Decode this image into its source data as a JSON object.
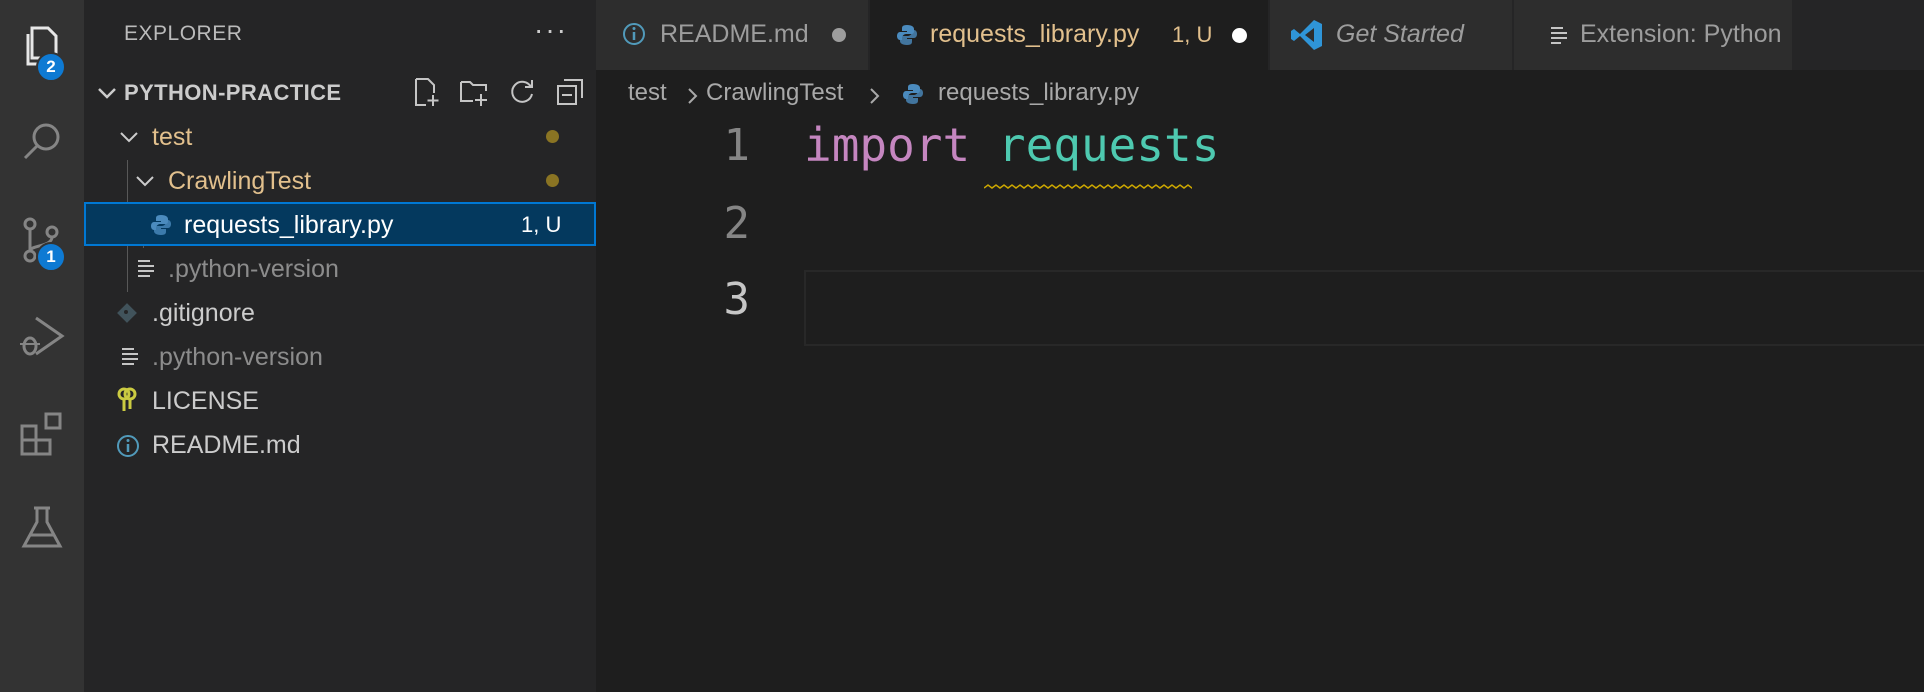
{
  "activity_bar": {
    "explorer_badge": "2",
    "scm_badge": "1",
    "icons": [
      "files-icon",
      "search-icon",
      "source-control-icon",
      "run-debug-icon",
      "extensions-icon",
      "testing-icon"
    ]
  },
  "sidebar": {
    "header": "EXPLORER",
    "more": "···",
    "section_title": "PYTHON-PRACTICE",
    "tree": [
      {
        "label": "test",
        "kind": "folder",
        "status_dot": true
      },
      {
        "label": "CrawlingTest",
        "kind": "folder",
        "status_dot": true
      },
      {
        "label": "requests_library.py",
        "kind": "python-file",
        "status": "1, U",
        "selected": true
      },
      {
        "label": ".python-version",
        "kind": "text-file"
      },
      {
        "label": ".gitignore",
        "kind": "git-file"
      },
      {
        "label": ".python-version",
        "kind": "text-file"
      },
      {
        "label": "LICENSE",
        "kind": "license-file"
      },
      {
        "label": "README.md",
        "kind": "info-file"
      }
    ]
  },
  "tabs": [
    {
      "label": "README.md",
      "modified": true,
      "icon": "info-icon"
    },
    {
      "label": "requests_library.py",
      "badge": "1, U",
      "modified": true,
      "active": true,
      "icon": "python-icon"
    },
    {
      "label": "Get Started",
      "icon": "vscode-icon"
    },
    {
      "label": "Extension: Python",
      "icon": "preview-icon"
    }
  ],
  "breadcrumb": [
    "test",
    "CrawlingTest",
    "requests_library.py"
  ],
  "editor": {
    "lines": [
      "1",
      "2",
      "3"
    ],
    "code_keyword": "import",
    "code_module": "requests"
  },
  "colors": {
    "accent": "#0078d4",
    "modified_folder": "#e2c08d",
    "keyword": "#c586c0",
    "module": "#4ec9b0",
    "badge": "#0e7ad3"
  }
}
